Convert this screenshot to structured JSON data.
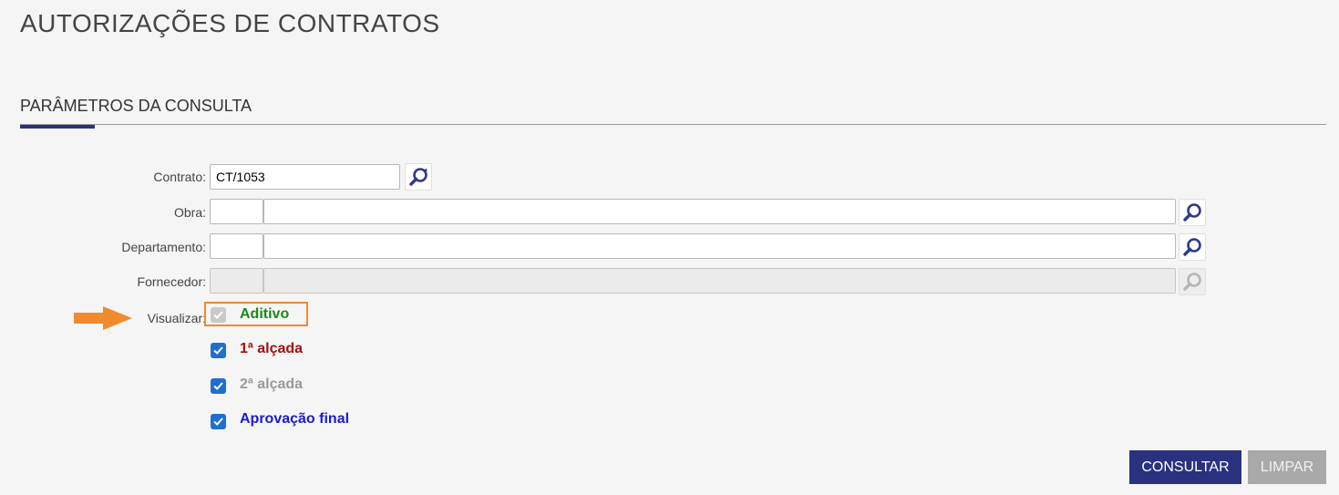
{
  "page": {
    "title": "AUTORIZAÇÕES DE CONTRATOS"
  },
  "section": {
    "title": "PARÂMETROS DA CONSULTA"
  },
  "form": {
    "contrato": {
      "label": "Contrato:",
      "value": "CT/1053"
    },
    "obra": {
      "label": "Obra:",
      "code": "",
      "name": ""
    },
    "departamento": {
      "label": "Departamento:",
      "code": "",
      "name": ""
    },
    "fornecedor": {
      "label": "Fornecedor:",
      "code": "",
      "name": ""
    },
    "visualizar": {
      "label": "Visualizar:",
      "options": [
        {
          "label": "Aditivo",
          "checked": true,
          "disabled": true,
          "color": "#1a8a1a"
        },
        {
          "label": "1ª alçada",
          "checked": true,
          "disabled": false,
          "color": "#a11010"
        },
        {
          "label": "2ª alçada",
          "checked": true,
          "disabled": false,
          "color": "#9a9a9a"
        },
        {
          "label": "Aprovação final",
          "checked": true,
          "disabled": false,
          "color": "#1a1ad0"
        }
      ]
    }
  },
  "buttons": {
    "consultar": "CONSULTAR",
    "limpar": "LIMPAR"
  },
  "colors": {
    "primary": "#29327f",
    "accent_arrow": "#f28a2e",
    "checkbox": "#1f6fd1"
  },
  "icons": {
    "search": "magnifier-icon",
    "search_refresh": "search-refresh-icon",
    "arrow": "arrow-right-icon",
    "check": "check-icon"
  }
}
